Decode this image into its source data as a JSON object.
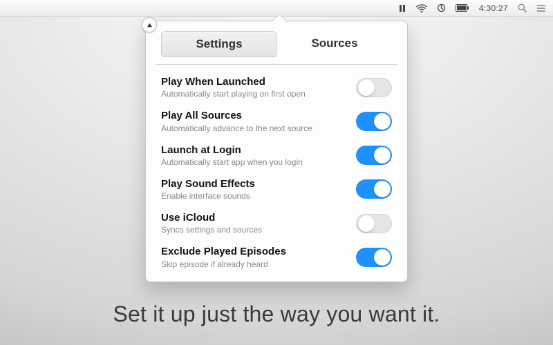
{
  "menubar": {
    "clock": "4:30:27"
  },
  "popover": {
    "tabs": {
      "settings": "Settings",
      "sources": "Sources"
    },
    "rows": [
      {
        "title": "Play When Launched",
        "sub": "Automatically start playing on first open",
        "on": false
      },
      {
        "title": "Play All Sources",
        "sub": "Automatically advance to the next source",
        "on": true
      },
      {
        "title": "Launch at Login",
        "sub": "Automatically start app when you login",
        "on": true
      },
      {
        "title": "Play Sound Effects",
        "sub": "Enable interface sounds",
        "on": true
      },
      {
        "title": "Use iCloud",
        "sub": "Syncs settings and sources",
        "on": false
      },
      {
        "title": "Exclude Played Episodes",
        "sub": "Skip episode if already heard",
        "on": true
      }
    ]
  },
  "tagline": "Set it up just the way you want it."
}
